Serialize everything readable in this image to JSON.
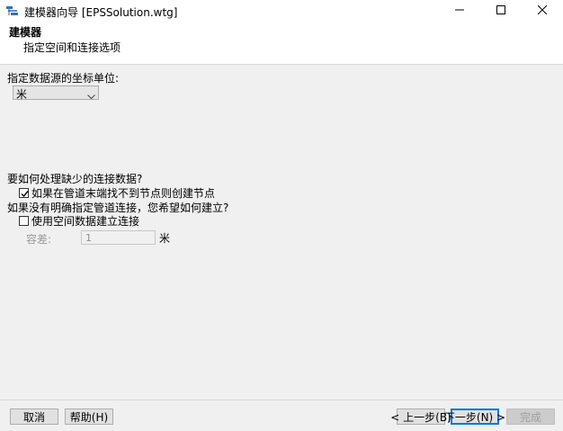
{
  "window": {
    "title": "建模器向导 [EPSSolution.wtg]"
  },
  "header": {
    "title": "建模器",
    "subtitle": "指定空间和连接选项"
  },
  "units": {
    "label": "指定数据源的坐标单位:",
    "selected": "米"
  },
  "missing": {
    "question": "要如何处理缺少的连接数据?",
    "create_nodes_label": "如果在管道末端找不到节点则创建节点",
    "create_nodes_checked": true
  },
  "connectivity": {
    "question": "如果没有明确指定管道连接，您希望如何建立?",
    "spatial_label": "使用空间数据建立连接",
    "spatial_checked": false,
    "tolerance_label": "容差:",
    "tolerance_value": "1",
    "tolerance_unit": "米"
  },
  "buttons": {
    "cancel": "取消",
    "help": "帮助(H)",
    "back": "< 上一步(B)",
    "next": "下一步(N) >",
    "finish": "完成"
  }
}
